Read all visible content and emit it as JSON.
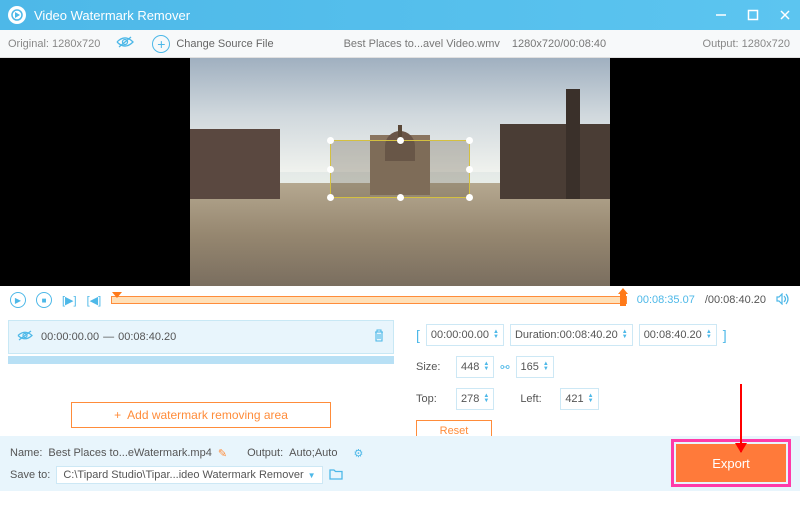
{
  "titlebar": {
    "title": "Video Watermark Remover"
  },
  "toolbar": {
    "original": "Original: 1280x720",
    "change_source": "Change Source File",
    "filename": "Best Places to...avel Video.wmv",
    "fileinfo": "1280x720/00:08:40",
    "output": "Output: 1280x720"
  },
  "playback": {
    "current": "00:08:35.07",
    "total": "/00:08:40.20"
  },
  "segment": {
    "start": "00:00:00.00",
    "sep": "—",
    "end": "00:08:40.20"
  },
  "add_area": "Add watermark removing area",
  "controls": {
    "time_start": "00:00:00.00",
    "duration_lbl": "Duration:",
    "duration_val": "00:08:40.20",
    "time_end": "00:08:40.20",
    "size_lbl": "Size:",
    "size_w": "448",
    "size_h": "165",
    "top_lbl": "Top:",
    "top_val": "278",
    "left_lbl": "Left:",
    "left_val": "421",
    "reset": "Reset"
  },
  "footer": {
    "name_lbl": "Name:",
    "name_val": "Best Places to...eWatermark.mp4",
    "output_lbl": "Output:",
    "output_val": "Auto;Auto",
    "save_lbl": "Save to:",
    "save_path": "C:\\Tipard Studio\\Tipar...ideo Watermark Remover",
    "export": "Export"
  }
}
